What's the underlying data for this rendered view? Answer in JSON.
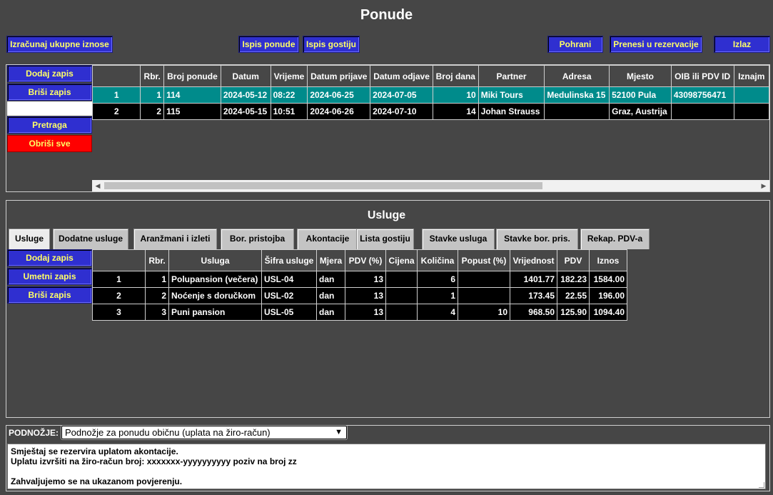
{
  "page": {
    "title": "Ponude"
  },
  "toolbar": {
    "calculate": "Izračunaj ukupne iznose",
    "print_offer": "Ispis ponude",
    "print_guests": "Ispis gostiju",
    "save": "Pohrani",
    "transfer": "Prenesi u rezervacije",
    "exit": "Izlaz"
  },
  "offers": {
    "side_buttons": {
      "add": "Dodaj zapis",
      "delete": "Briši zapis",
      "search": "Pretraga",
      "clear_all": "Obriši sve"
    },
    "search_value": "",
    "columns": [
      "",
      "Rbr.",
      "Broj ponude",
      "Datum",
      "Vrijeme",
      "Datum prijave",
      "Datum odjave",
      "Broj dana",
      "Partner",
      "Adresa",
      "Mjesto",
      "OIB ili PDV ID",
      "Iznajm"
    ],
    "rows": [
      [
        "1",
        "1",
        "114",
        "2024-05-12",
        "08:22",
        "2024-06-25",
        "2024-07-05",
        "10",
        "Miki Tours",
        "Medulinska 15",
        "52100 Pula",
        "43098756471",
        ""
      ],
      [
        "2",
        "2",
        "115",
        "2024-05-15",
        "10:51",
        "2024-06-26",
        "2024-07-10",
        "14",
        "Johan Strauss",
        "",
        "Graz, Austrija",
        "",
        ""
      ]
    ]
  },
  "services": {
    "title": "Usluge",
    "tabs": [
      "Usluge",
      "Dodatne usluge",
      "Aranžmani i izleti",
      "Bor. pristojba",
      "Akontacije",
      "Lista gostiju",
      "Stavke usluga",
      "Stavke bor. pris.",
      "Rekap. PDV-a"
    ],
    "active_tab": "Usluge",
    "side_buttons": {
      "add": "Dodaj zapis",
      "insert": "Umetni zapis",
      "delete": "Briši zapis"
    },
    "columns": [
      "",
      "Rbr.",
      "Usluga",
      "Šifra usluge",
      "Mjera",
      "PDV (%)",
      "Cijena",
      "Količina",
      "Popust (%)",
      "Vrijednost",
      "PDV",
      "Iznos"
    ],
    "rows": [
      [
        "1",
        "1",
        "Polupansion (večera)",
        "USL-04",
        "dan",
        "13",
        "",
        "6",
        "",
        "1401.77",
        "182.23",
        "1584.00"
      ],
      [
        "2",
        "2",
        "Noćenje s doručkom",
        "USL-02",
        "dan",
        "13",
        "",
        "1",
        "",
        "173.45",
        "22.55",
        "196.00"
      ],
      [
        "3",
        "3",
        "Puni pansion",
        "USL-05",
        "dan",
        "13",
        "",
        "4",
        "10",
        "968.50",
        "125.90",
        "1094.40"
      ]
    ]
  },
  "footer": {
    "label": "PODNOŽJE:",
    "selected": "Podnožje za ponudu običnu (uplata na žiro-račun)",
    "text": "Smještaj se rezervira uplatom akontacije.\nUplatu izvršiti na žiro-račun broj: xxxxxxx-yyyyyyyyyy poziv na broj zz\n\nZahvaljujemo se na ukazanom povjerenju."
  },
  "colors": {
    "background": "#464646",
    "button": "#2f2fd0",
    "button_text": "#ffff66",
    "danger": "#ff0000",
    "selected_row": "#008b8b"
  }
}
